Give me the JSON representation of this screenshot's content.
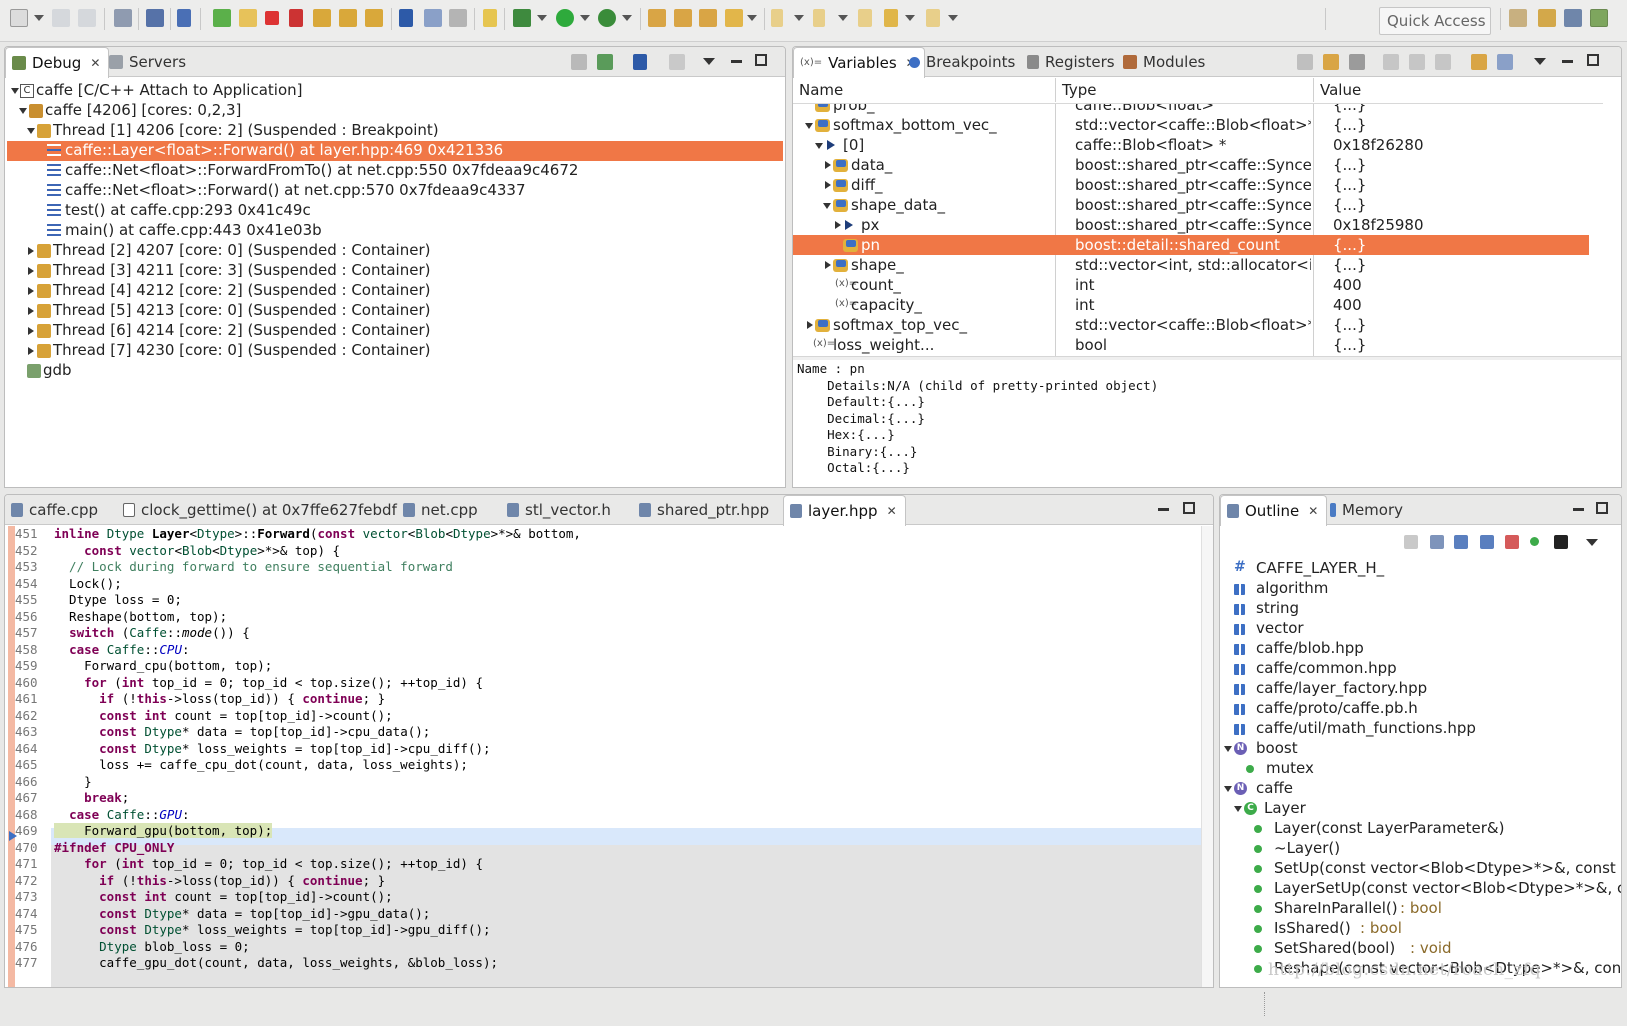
{
  "toolbar": {
    "quick_access": "Quick Access"
  },
  "debug_panel": {
    "tabs": [
      {
        "label": "Debug"
      },
      {
        "label": "Servers"
      }
    ],
    "tree": [
      {
        "text": "caffe [C/C++ Attach to Application]"
      },
      {
        "text": "caffe [4206] [cores: 0,2,3]"
      },
      {
        "text": "Thread [1] 4206 [core: 2] (Suspended : Breakpoint)"
      },
      {
        "text": "caffe::Layer<float>::Forward() at layer.hpp:469 0x421336"
      },
      {
        "text": "caffe::Net<float>::ForwardFromTo() at net.cpp:550 0x7fdeaa9c4672"
      },
      {
        "text": "caffe::Net<float>::Forward() at net.cpp:570 0x7fdeaa9c4337"
      },
      {
        "text": "test() at caffe.cpp:293 0x41c49c"
      },
      {
        "text": "main() at caffe.cpp:443 0x41e03b"
      },
      {
        "text": "Thread [2] 4207 [core: 0] (Suspended : Container)"
      },
      {
        "text": "Thread [3] 4211 [core: 3] (Suspended : Container)"
      },
      {
        "text": "Thread [4] 4212 [core: 2] (Suspended : Container)"
      },
      {
        "text": "Thread [5] 4213 [core: 0] (Suspended : Container)"
      },
      {
        "text": "Thread [6] 4214 [core: 2] (Suspended : Container)"
      },
      {
        "text": "Thread [7] 4230 [core: 0] (Suspended : Container)"
      },
      {
        "text": "gdb"
      }
    ]
  },
  "variables_panel": {
    "tabs": [
      {
        "label": "Variables"
      },
      {
        "label": "Breakpoints"
      },
      {
        "label": "Registers"
      },
      {
        "label": "Modules"
      }
    ],
    "columns": {
      "name": "Name",
      "type": "Type",
      "value": "Value"
    },
    "rows": [
      {
        "name": "prob_",
        "type": "caffe::Blob<float>",
        "value": "{...}"
      },
      {
        "name": "softmax_bottom_vec_",
        "type": "std::vector<caffe::Blob<float>*, std:",
        "value": "{...}"
      },
      {
        "name": "[0]",
        "type": "caffe::Blob<float> *",
        "value": "0x18f26280"
      },
      {
        "name": "data_",
        "type": "boost::shared_ptr<caffe::SyncedMer",
        "value": "{...}"
      },
      {
        "name": "diff_",
        "type": "boost::shared_ptr<caffe::SyncedMer",
        "value": "{...}"
      },
      {
        "name": "shape_data_",
        "type": "boost::shared_ptr<caffe::SyncedMer",
        "value": "{...}"
      },
      {
        "name": "px",
        "type": "boost::shared_ptr<caffe::SyncedMer",
        "value": "0x18f25980"
      },
      {
        "name": "pn",
        "type": "boost::detail::shared_count",
        "value": "{...}"
      },
      {
        "name": "shape_",
        "type": "std::vector<int, std::allocator<int> >",
        "value": "{...}"
      },
      {
        "name": "count_",
        "type": "int",
        "value": "400"
      },
      {
        "name": "capacity_",
        "type": "int",
        "value": "400"
      },
      {
        "name": "softmax_top_vec_",
        "type": "std::vector<caffe::Blob<float>*, std:",
        "value": "{...}"
      },
      {
        "name": "loss_weight...",
        "type": "bool",
        "value": "{...}"
      }
    ],
    "details": [
      "Name : pn",
      "    Details:N/A (child of pretty-printed object)",
      "    Default:{...}",
      "    Decimal:{...}",
      "    Hex:{...}",
      "    Binary:{...}",
      "    Octal:{...}"
    ]
  },
  "editor": {
    "tabs": [
      {
        "label": "caffe.cpp"
      },
      {
        "label": "clock_gettime() at 0x7ffe627febdf"
      },
      {
        "label": "net.cpp"
      },
      {
        "label": "stl_vector.h"
      },
      {
        "label": "shared_ptr.hpp"
      },
      {
        "label": "layer.hpp"
      }
    ],
    "lines": [
      {
        "n": "451",
        "code": "inline Dtype Layer<Dtype>::Forward(const vector<Blob<Dtype>*>& bottom,"
      },
      {
        "n": "452",
        "code": "    const vector<Blob<Dtype>*>& top) {"
      },
      {
        "n": "453",
        "code": "  // Lock during forward to ensure sequential forward"
      },
      {
        "n": "454",
        "code": "  Lock();"
      },
      {
        "n": "455",
        "code": "  Dtype loss = 0;"
      },
      {
        "n": "456",
        "code": "  Reshape(bottom, top);"
      },
      {
        "n": "457",
        "code": "  switch (Caffe::mode()) {"
      },
      {
        "n": "458",
        "code": "  case Caffe::CPU:"
      },
      {
        "n": "459",
        "code": "    Forward_cpu(bottom, top);"
      },
      {
        "n": "460",
        "code": "    for (int top_id = 0; top_id < top.size(); ++top_id) {"
      },
      {
        "n": "461",
        "code": "      if (!this->loss(top_id)) { continue; }"
      },
      {
        "n": "462",
        "code": "      const int count = top[top_id]->count();"
      },
      {
        "n": "463",
        "code": "      const Dtype* data = top[top_id]->cpu_data();"
      },
      {
        "n": "464",
        "code": "      const Dtype* loss_weights = top[top_id]->cpu_diff();"
      },
      {
        "n": "465",
        "code": "      loss += caffe_cpu_dot(count, data, loss_weights);"
      },
      {
        "n": "466",
        "code": "    }"
      },
      {
        "n": "467",
        "code": "    break;"
      },
      {
        "n": "468",
        "code": "  case Caffe::GPU:"
      },
      {
        "n": "469",
        "code": "    Forward_gpu(bottom, top);"
      },
      {
        "n": "470",
        "code": "#ifndef CPU_ONLY"
      },
      {
        "n": "471",
        "code": "    for (int top_id = 0; top_id < top.size(); ++top_id) {"
      },
      {
        "n": "472",
        "code": "      if (!this->loss(top_id)) { continue; }"
      },
      {
        "n": "473",
        "code": "      const int count = top[top_id]->count();"
      },
      {
        "n": "474",
        "code": "      const Dtype* data = top[top_id]->gpu_data();"
      },
      {
        "n": "475",
        "code": "      const Dtype* loss_weights = top[top_id]->gpu_diff();"
      },
      {
        "n": "476",
        "code": "      Dtype blob_loss = 0;"
      },
      {
        "n": "477",
        "code": "      caffe_gpu_dot(count, data, loss_weights, &blob_loss);"
      }
    ]
  },
  "outline_panel": {
    "tabs": [
      {
        "label": "Outline"
      },
      {
        "label": "Memory"
      }
    ],
    "items": [
      {
        "text": "CAFFE_LAYER_H_"
      },
      {
        "text": "algorithm"
      },
      {
        "text": "string"
      },
      {
        "text": "vector"
      },
      {
        "text": "caffe/blob.hpp"
      },
      {
        "text": "caffe/common.hpp"
      },
      {
        "text": "caffe/layer_factory.hpp"
      },
      {
        "text": "caffe/proto/caffe.pb.h"
      },
      {
        "text": "caffe/util/math_functions.hpp"
      },
      {
        "text": "boost"
      },
      {
        "text": "mutex"
      },
      {
        "text": "caffe"
      },
      {
        "text": "Layer"
      },
      {
        "text": "Layer(const LayerParameter&)"
      },
      {
        "text": "~Layer()"
      },
      {
        "text": "SetUp(const vector<Blob<Dtype>*>&, const vector"
      },
      {
        "text": "LayerSetUp(const vector<Blob<Dtype>*>&, const v"
      },
      {
        "text": "ShareInParallel()",
        "ret": ": bool"
      },
      {
        "text": "IsShared()",
        "ret": ": bool"
      },
      {
        "text": "SetShared(bool)",
        "ret": ": void"
      },
      {
        "text": "Reshape(const vector<Blob<Dtype>*>&, const vect"
      }
    ]
  },
  "watermark": "http://blog.csdn.net/roach_zfq",
  "colors": {
    "selection": "#f07746",
    "current_line": "#d9e8fb",
    "disabled_block": "#e3e3e3"
  }
}
